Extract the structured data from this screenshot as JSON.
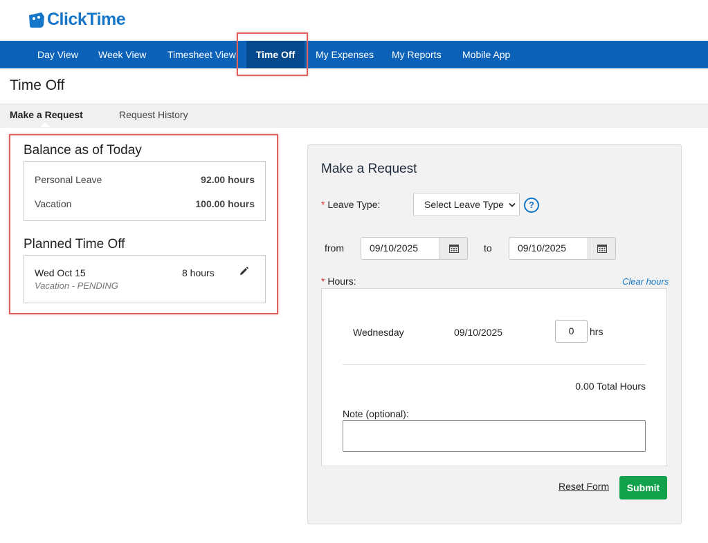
{
  "app": {
    "logo_text": "ClickTime"
  },
  "nav": {
    "items": [
      {
        "label": "Day View"
      },
      {
        "label": "Week View"
      },
      {
        "label": "Timesheet View"
      },
      {
        "label": "Time Off"
      },
      {
        "label": "My Expenses"
      },
      {
        "label": "My Reports"
      },
      {
        "label": "Mobile App"
      }
    ],
    "active": "Time Off"
  },
  "page": {
    "title": "Time Off"
  },
  "subtabs": [
    {
      "label": "Make a Request"
    },
    {
      "label": "Request History"
    }
  ],
  "balance": {
    "title": "Balance as of Today",
    "items": [
      {
        "label": "Personal Leave",
        "value": "92.00 hours"
      },
      {
        "label": "Vacation",
        "value": "100.00 hours"
      }
    ]
  },
  "planned": {
    "title": "Planned Time Off",
    "items": [
      {
        "date": "Wed Oct 15",
        "hours": "8 hours",
        "status": "Vacation - PENDING"
      }
    ]
  },
  "request_form": {
    "title": "Make a Request",
    "required_marker": "*",
    "leave_type_label": "Leave Type:",
    "leave_type_selected": "Select Leave Type",
    "help_icon_glyph": "?",
    "from_label": "from",
    "from_date": "09/10/2025",
    "to_label": "to",
    "to_date": "09/10/2025",
    "hours_label": "Hours:",
    "clear_hours": "Clear hours",
    "day_row": {
      "day": "Wednesday",
      "date": "09/10/2025",
      "hours": "0",
      "unit": "hrs"
    },
    "total": "0.00 Total Hours",
    "note_label": "Note (optional):",
    "note_value": "",
    "reset_label": "Reset Form",
    "submit_label": "Submit"
  },
  "colors": {
    "nav_bg": "#0b62b8",
    "nav_active": "#064a8d",
    "brand": "#1676c8",
    "submit": "#12a24b",
    "highlight": "#e06060",
    "required": "#d0312d"
  }
}
